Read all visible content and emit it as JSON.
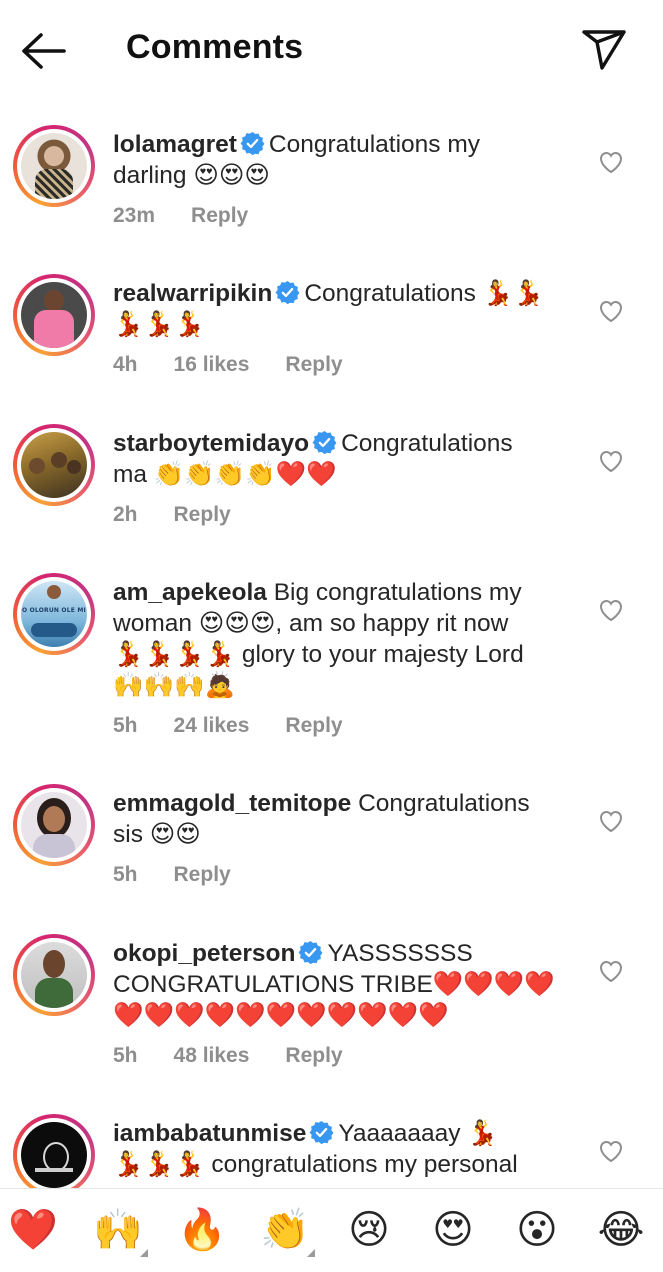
{
  "header": {
    "title": "Comments"
  },
  "comments": [
    {
      "username": "lolamagret",
      "verified": true,
      "text_line1": "Congratulations my",
      "text_line2": "darling 😍😍😍",
      "time": "23m",
      "likes": "",
      "reply": "Reply"
    },
    {
      "username": "realwarripikin",
      "verified": true,
      "text_line1": "Congratulations 💃💃",
      "text_line2": "💃💃💃",
      "time": "4h",
      "likes": "16 likes",
      "reply": "Reply"
    },
    {
      "username": "starboytemidayo",
      "verified": true,
      "text_line1": "Congratulations",
      "text_line2": "ma 👏👏👏👏❤️❤️",
      "time": "2h",
      "likes": "",
      "reply": "Reply"
    },
    {
      "username": "am_apekeola",
      "verified": false,
      "text_line1": "Big congratulations my",
      "text_line2": "woman 😍😍😍, am so happy rit now",
      "text_line3": "💃💃💃💃 glory to your majesty Lord",
      "text_line4": "🙌🙌🙌🙇",
      "avatar_caption": "O OLORUN OLE MI",
      "time": "5h",
      "likes": "24 likes",
      "reply": "Reply"
    },
    {
      "username": "emmagold_temitope",
      "verified": false,
      "text_line1": "Congratulations",
      "text_line2": "sis 😍😍",
      "time": "5h",
      "likes": "",
      "reply": "Reply"
    },
    {
      "username": "okopi_peterson",
      "verified": true,
      "text_line1": "YASSSSSSS",
      "text_line2": "CONGRATULATIONS TRIBE❤️❤️❤️❤️",
      "text_line3": "❤️❤️❤️❤️❤️❤️❤️❤️❤️❤️❤️",
      "time": "5h",
      "likes": "48 likes",
      "reply": "Reply"
    },
    {
      "username": "iambabatunmise",
      "verified": true,
      "text_line1": "Yaaaaaaay 💃",
      "text_line2": "💃💃💃 congratulations my personal",
      "time": "",
      "likes": "",
      "reply": ""
    }
  ],
  "quick_reactions": [
    "❤️",
    "🙌",
    "🔥",
    "👏",
    "😢",
    "😍",
    "😮",
    "😂"
  ],
  "colors": {
    "accent_verified": "#3897f0",
    "meta_gray": "#8e8e8e",
    "text": "#262626"
  }
}
